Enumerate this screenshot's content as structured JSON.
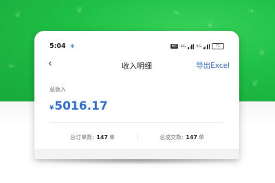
{
  "status": {
    "time": "5:04",
    "battery": "71"
  },
  "nav": {
    "title": "收入明细",
    "export_label": "导出Excel"
  },
  "summary": {
    "total_label": "总收入",
    "currency": "¥",
    "amount": "5016.17"
  },
  "stats": {
    "orders_label": "总订单数:",
    "orders_value": "147",
    "orders_unit": "单",
    "deals_label": "总成交数:",
    "deals_value": "147",
    "deals_unit": "单"
  },
  "colors": {
    "accent": "#2f6fd6",
    "background_green": "#1fbf45"
  }
}
